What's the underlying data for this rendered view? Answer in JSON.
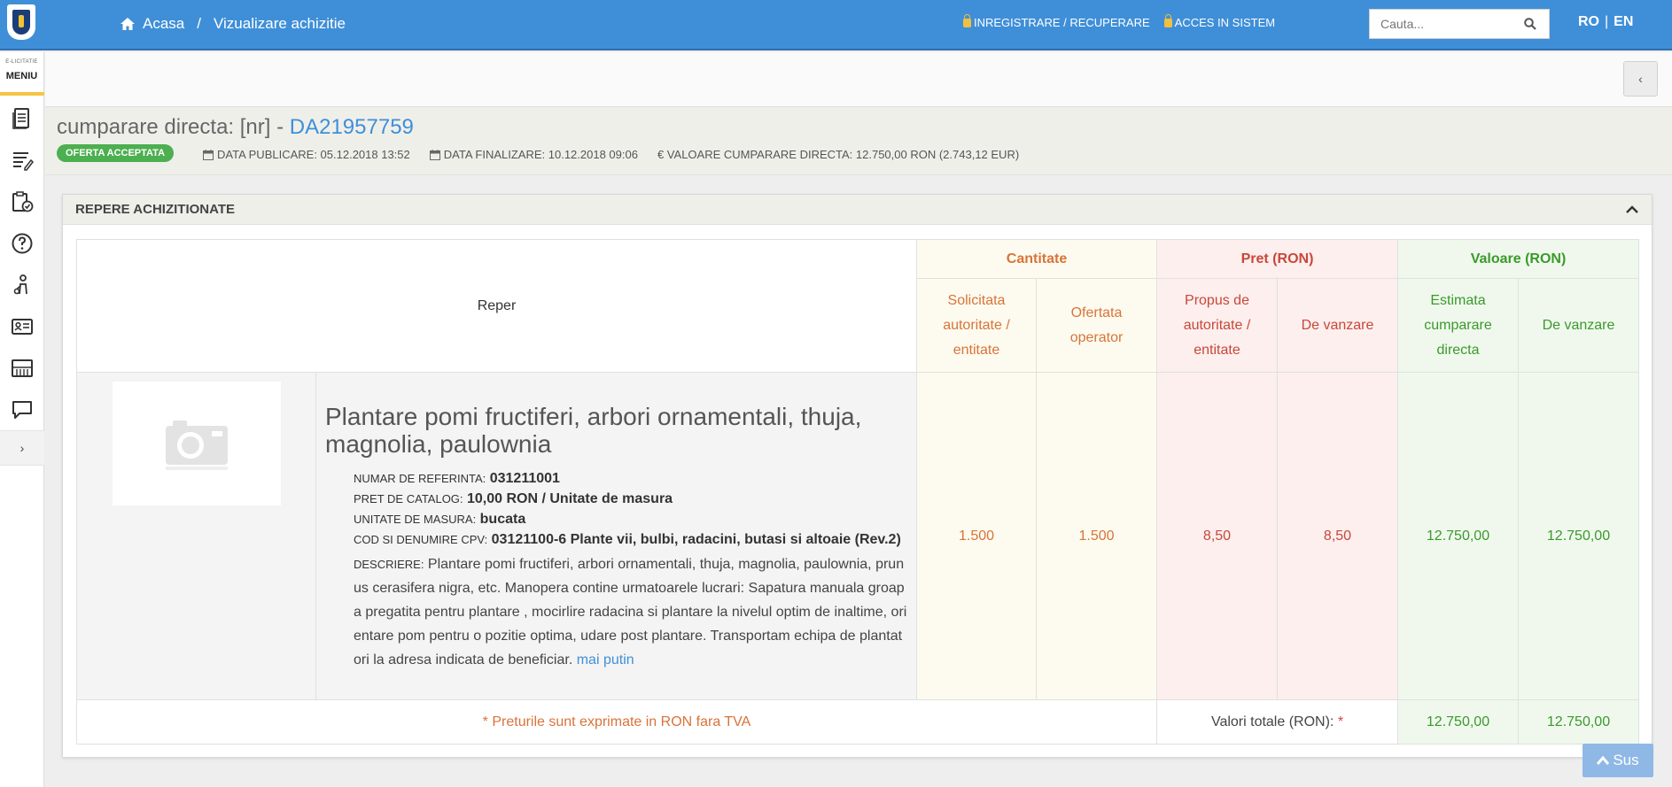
{
  "header": {
    "breadcrumb": {
      "home": "Acasa",
      "separator": "/",
      "current": "Vizualizare achizitie"
    },
    "links": {
      "register": "INREGISTRARE / RECUPERARE",
      "login": "ACCES IN SISTEM"
    },
    "search": {
      "placeholder": "Cauta...",
      "value": ""
    },
    "lang": {
      "ro": "RO",
      "sep": "|",
      "en": "EN"
    }
  },
  "sidebar": {
    "brand": "E-LICITATIE",
    "menu_label": "MENIU",
    "items": [
      {
        "icon": "document-icon"
      },
      {
        "icon": "list-edit-icon"
      },
      {
        "icon": "clipboard-check-icon"
      },
      {
        "icon": "help-icon"
      },
      {
        "icon": "person-icon"
      },
      {
        "icon": "id-card-icon"
      },
      {
        "icon": "catalog-icon"
      },
      {
        "icon": "chat-icon"
      }
    ],
    "expand": "›"
  },
  "subbar": {
    "collapse": "‹"
  },
  "page": {
    "title_prefix": "cumparare directa: [nr] -",
    "title_code": "DA21957759",
    "status": "OFERTA ACCEPTATA",
    "publish_label": "DATA PUBLICARE: 05.12.2018 13:52",
    "finalize_label": "DATA FINALIZARE: 10.12.2018 09:06",
    "value_label": "€ VALOARE CUMPARARE DIRECTA: 12.750,00  RON (2.743,12  EUR)"
  },
  "panel": {
    "title": "REPERE ACHIZITIONATE",
    "table": {
      "reper_header": "Reper",
      "groups": {
        "cantitate": "Cantitate",
        "pret": "Pret (RON)",
        "valoare": "Valoare (RON)"
      },
      "subheaders": {
        "solicitata": "Solicitata autoritate / entitate",
        "ofertata": "Ofertata operator",
        "propus": "Propus de autoritate / entitate",
        "de_vanzare_pret": "De vanzare",
        "estimata": "Estimata cumparare directa",
        "de_vanzare_val": "De vanzare"
      },
      "row": {
        "title": "Plantare pomi fructiferi, arbori ornamentali, thuja, magnolia, paulownia",
        "ref_label": "NUMAR DE REFERINTA:",
        "ref_value": "031211001",
        "catalog_label": "PRET DE CATALOG:",
        "catalog_value": "10,00  RON / Unitate de masura",
        "unit_label": "UNITATE DE MASURA:",
        "unit_value": "bucata",
        "cpv_label": "COD SI DENUMIRE CPV:",
        "cpv_value": "03121100-6 Plante vii, bulbi, radacini, butasi si altoaie (Rev.2)",
        "desc_label": "DESCRIERE:",
        "desc_value": "Plantare pomi fructiferi, arbori ornamentali, thuja, magnolia, paulownia, prunus cerasifera nigra, etc. Manopera contine urmatoarele lucrari: Sapatura manuala groapa pregatita pentru plantare , mocirlire radacina si plantare la nivelul optim de inaltime, orientare pom pentru o pozitie optima, udare post plantare. Transportam echipa de plantatori la adresa indicata de beneficiar.",
        "less_link": "mai putin",
        "solicitata": "1.500",
        "ofertata": "1.500",
        "propus": "8,50",
        "de_vanzare_pret": "8,50",
        "estimata": "12.750,00",
        "de_vanzare_val": "12.750,00"
      },
      "footer": {
        "note": "* Preturile sunt exprimate in RON fara TVA",
        "totals_label": "Valori totale (RON):",
        "totals_req": "*",
        "total_estimata": "12.750,00",
        "total_vanzare": "12.750,00"
      }
    }
  },
  "sus_button": "Sus"
}
